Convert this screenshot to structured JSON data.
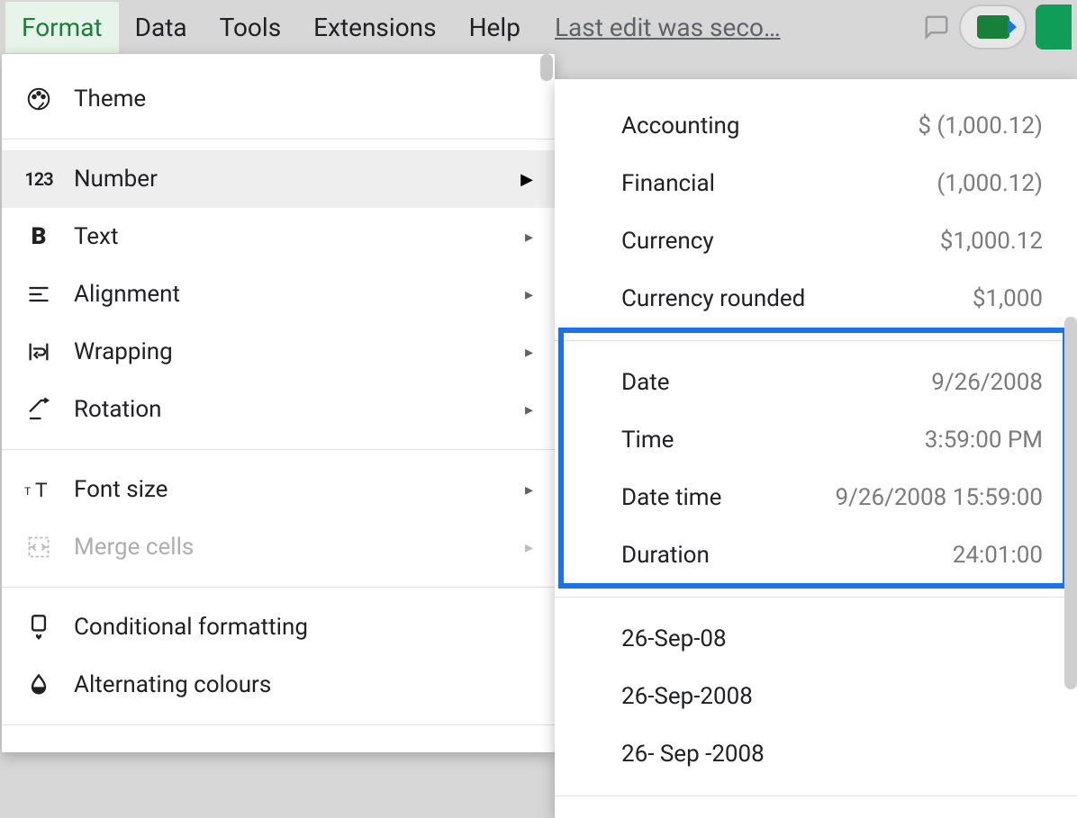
{
  "menubar": {
    "items": [
      "Format",
      "Data",
      "Tools",
      "Extensions",
      "Help"
    ],
    "active_index": 0,
    "last_edit": "Last edit was seco…"
  },
  "format_menu": {
    "theme": "Theme",
    "number": "Number",
    "text": "Text",
    "alignment": "Alignment",
    "wrapping": "Wrapping",
    "rotation": "Rotation",
    "font_size": "Font size",
    "merge_cells": "Merge cells",
    "conditional_formatting": "Conditional formatting",
    "alternating_colours": "Alternating colours"
  },
  "number_submenu": {
    "group_currency": [
      {
        "label": "Accounting",
        "example": "$ (1,000.12)"
      },
      {
        "label": "Financial",
        "example": "(1,000.12)"
      },
      {
        "label": "Currency",
        "example": "$1,000.12"
      },
      {
        "label": "Currency rounded",
        "example": "$1,000"
      }
    ],
    "group_datetime": [
      {
        "label": "Date",
        "example": "9/26/2008"
      },
      {
        "label": "Time",
        "example": "3:59:00 PM"
      },
      {
        "label": "Date time",
        "example": "9/26/2008 15:59:00"
      },
      {
        "label": "Duration",
        "example": "24:01:00"
      }
    ],
    "group_custom_dates": [
      {
        "label": "26-Sep-08",
        "example": ""
      },
      {
        "label": "26-Sep-2008",
        "example": ""
      },
      {
        "label": "26- Sep -2008",
        "example": ""
      }
    ]
  }
}
